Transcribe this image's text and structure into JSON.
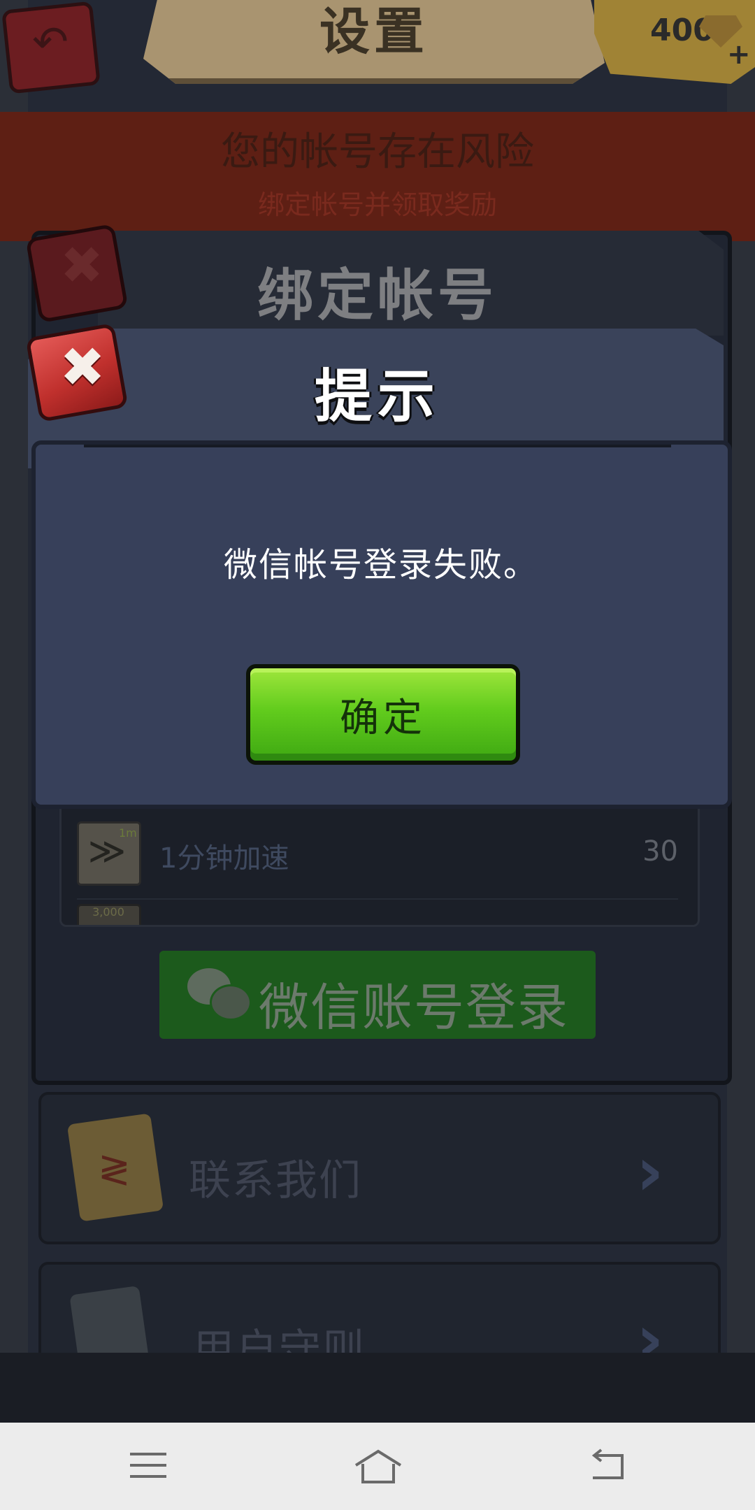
{
  "header": {
    "title": "设置",
    "gems": "400",
    "gem_plus": "+"
  },
  "risk_banner": {
    "title": "您的帐号存在风险",
    "subtitle": "绑定帐号并领取奖励"
  },
  "bind_panel": {
    "title": "绑定帐号",
    "rewards": [
      {
        "name": "1分钟加速",
        "value": "30",
        "icon_tag": "1m",
        "icon": "speedup-icon"
      },
      {
        "name": "",
        "value": "",
        "icon_tag": "3,000",
        "icon": "gold-icon"
      }
    ],
    "wechat_button": "微信账号登录"
  },
  "menu": {
    "contact": "联系我们",
    "terms": "用户守则"
  },
  "dialog": {
    "title": "提示",
    "message": "微信帐号登录失败。",
    "confirm": "确定"
  },
  "colors": {
    "confirm_green": "#62cc1d",
    "close_red": "#c0302d",
    "dialog_bg": "#37405a",
    "wechat_green": "#1c5a1c"
  }
}
